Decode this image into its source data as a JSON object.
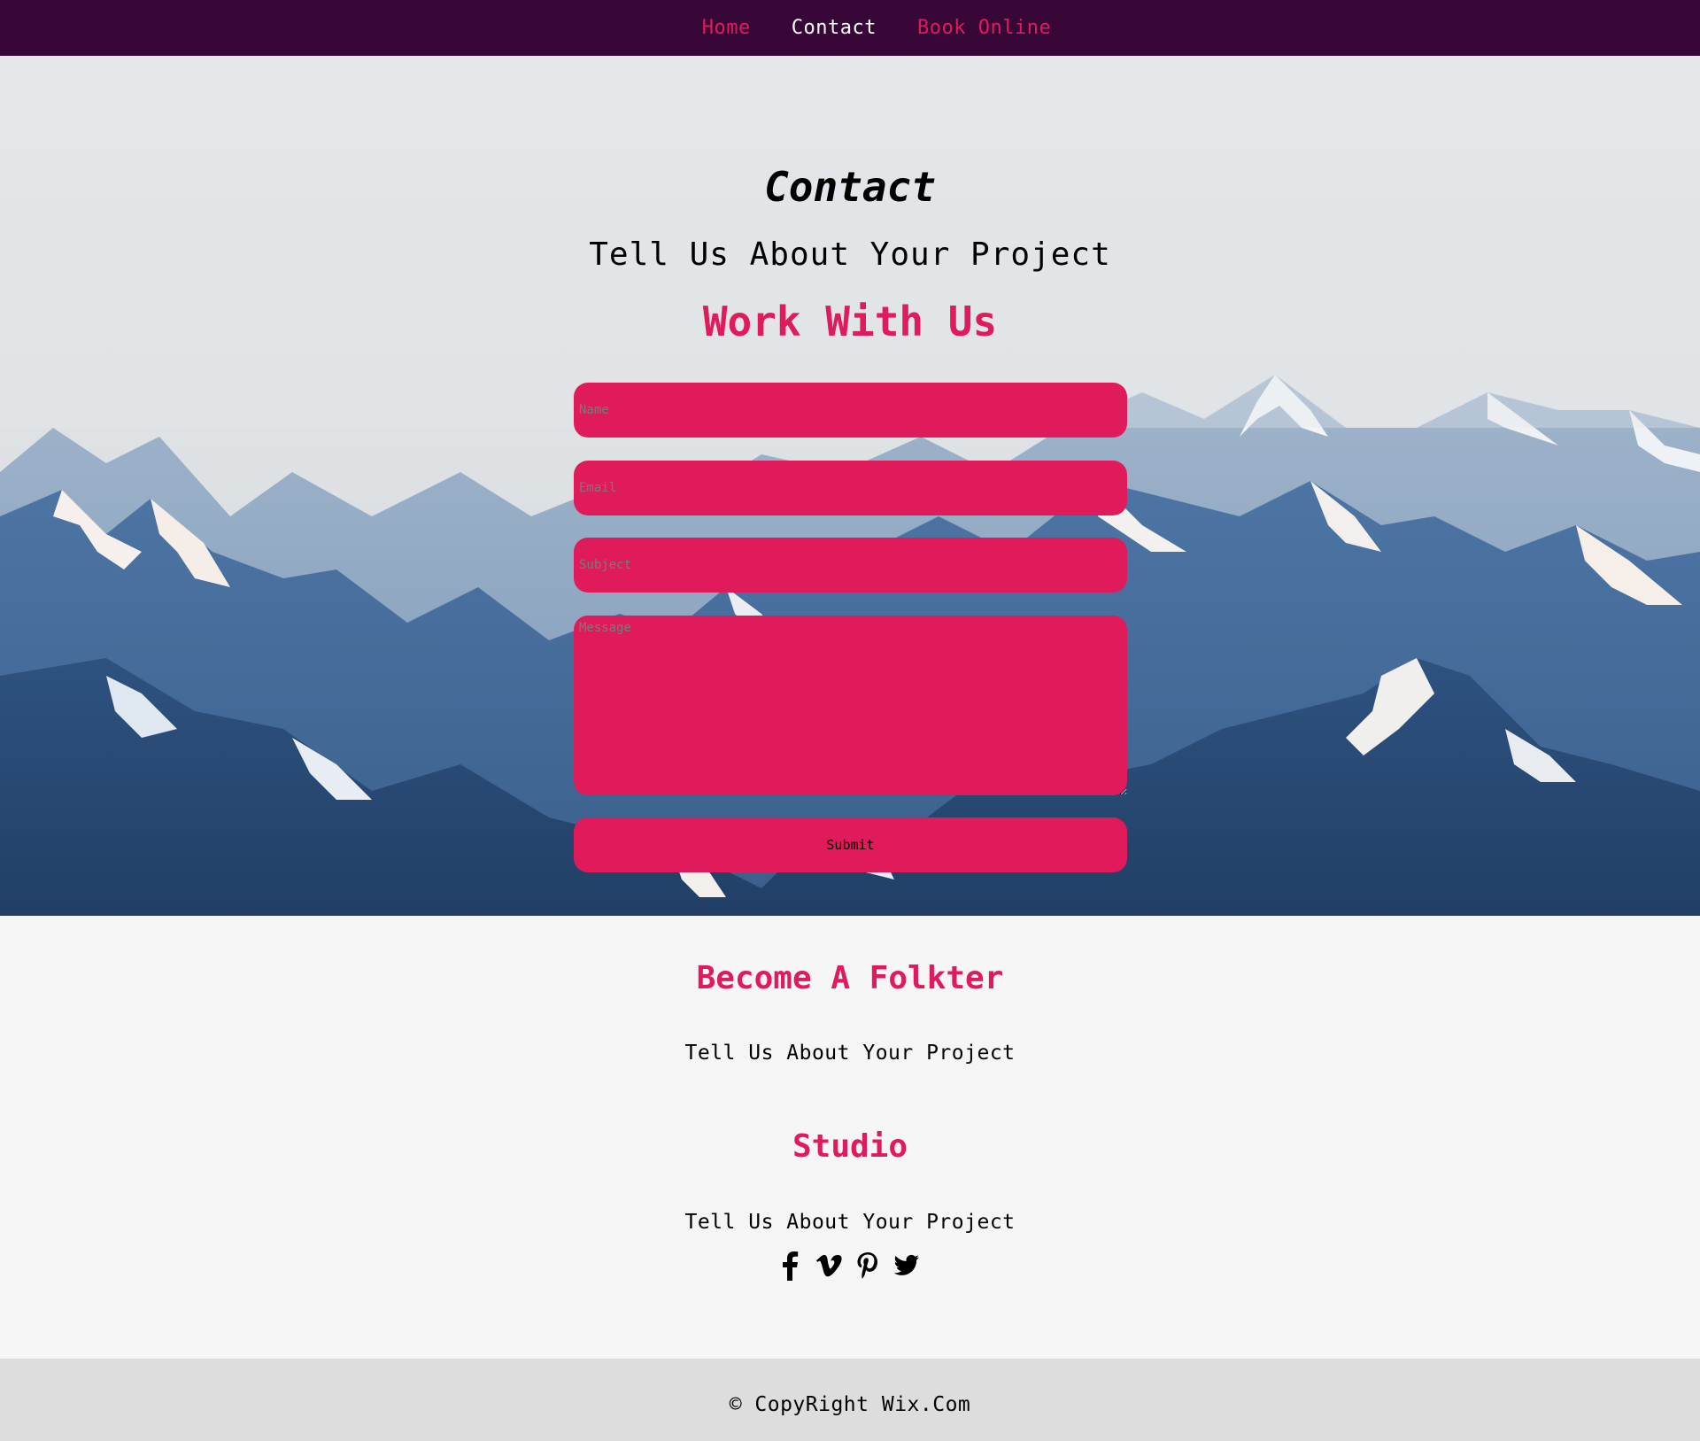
{
  "nav": {
    "items": [
      {
        "label": "Home"
      },
      {
        "label": "Contact"
      },
      {
        "label": "Book Online"
      }
    ],
    "active": "Contact"
  },
  "hero": {
    "title": "Contact",
    "subtitle": "Tell Us About Your Project",
    "heading": "Work With Us"
  },
  "form": {
    "name_placeholder": "Name",
    "email_placeholder": "Email",
    "subject_placeholder": "Subject",
    "message_placeholder": "Message",
    "submit_label": "Submit"
  },
  "info": {
    "become_heading": "Become A Folkter",
    "become_text": "Tell Us About Your Project",
    "studio_heading": "Studio",
    "studio_text": "Tell Us About Your Project"
  },
  "socials": [
    "facebook-icon",
    "vimeo-icon",
    "pinterest-icon",
    "twitter-icon"
  ],
  "footer": {
    "copyright": "© CopyRight Wix.Com"
  },
  "colors": {
    "nav_bg": "#370837",
    "accent": "#df1b5c",
    "info_bg": "#f5f5f5",
    "footer_bg": "#dddddd"
  }
}
